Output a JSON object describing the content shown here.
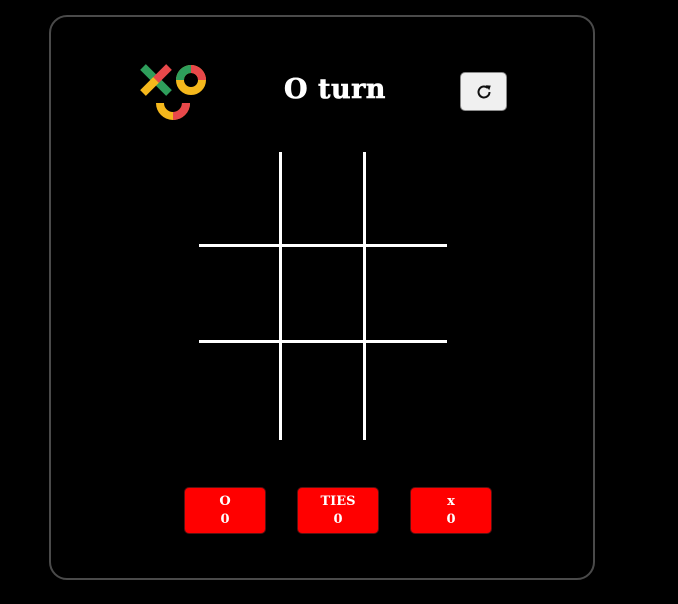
{
  "header": {
    "turn_text": "O turn",
    "logo_icon": "xo-logo-icon",
    "reset_icon": "refresh-icon"
  },
  "board": {
    "cells": [
      "",
      "",
      "",
      "",
      "",
      "",
      "",
      "",
      ""
    ],
    "line_color": "#ffffff"
  },
  "scores": [
    {
      "label": "O",
      "value": "0"
    },
    {
      "label": "TIES",
      "value": "0"
    },
    {
      "label": "x",
      "value": "0"
    }
  ],
  "colors": {
    "background": "#000000",
    "score_box": "#ff0000",
    "logo_green": "#2e9e5b",
    "logo_yellow": "#f5b81c",
    "logo_red": "#e8484a"
  }
}
